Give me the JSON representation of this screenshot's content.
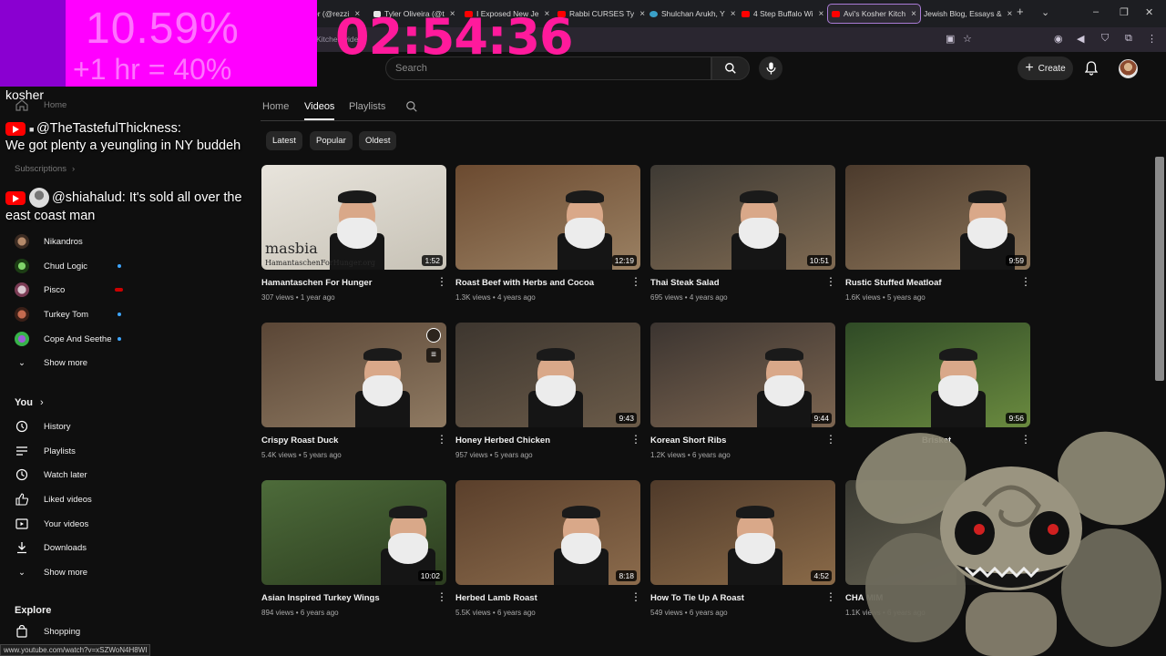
{
  "browser": {
    "tabs": [
      {
        "label": "er (@rezzi",
        "color": "#c9c9c9"
      },
      {
        "label": "Tyler Oliveira (@t",
        "color": "#e6e6e6"
      },
      {
        "label": "I Exposed New Je",
        "color": "#ff0000"
      },
      {
        "label": "Rabbi CURSES Ty",
        "color": "#ff0000"
      },
      {
        "label": "Shulchan Arukh, Y",
        "color": "#3aa0c8"
      },
      {
        "label": "4 Step Buffalo Wi",
        "color": "#ff0000"
      },
      {
        "label": "Avi's Kosher Kitch",
        "color": "#ff0000"
      },
      {
        "label": "Jewish Blog, Essays &",
        "color": "#6e6e6e"
      }
    ],
    "address_fragment": "Kitchen/videos"
  },
  "header": {
    "search_placeholder": "Search",
    "create_label": "Create"
  },
  "channel_tabs": {
    "home": "Home",
    "videos": "Videos",
    "playlists": "Playlists"
  },
  "chips": {
    "latest": "Latest",
    "popular": "Popular",
    "oldest": "Oldest"
  },
  "sidebar": {
    "home": "Home",
    "subscriptions": "Subscriptions",
    "subs": [
      {
        "name": "Nikandros",
        "live": false
      },
      {
        "name": "Chud Logic",
        "live": true
      },
      {
        "name": "Pisco",
        "live": true
      },
      {
        "name": "Turkey Tom",
        "live": true
      },
      {
        "name": "Cope And Seethe",
        "live": true
      }
    ],
    "show_more_1": "Show more",
    "you": "You",
    "you_items": [
      "History",
      "Playlists",
      "Watch later",
      "Liked videos",
      "Your videos",
      "Downloads"
    ],
    "show_more_2": "Show more",
    "explore": "Explore",
    "shopping": "Shopping"
  },
  "videos": [
    {
      "title": "Hamantaschen For Hunger",
      "views": "307 views",
      "age": "1 year ago",
      "duration": "1:52",
      "watermark": "masbia",
      "sub_watermark": "HamantaschenForHunger.org"
    },
    {
      "title": "Roast Beef with Herbs and Cocoa",
      "views": "1.3K views",
      "age": "4 years ago",
      "duration": "12:19"
    },
    {
      "title": "Thai Steak Salad",
      "views": "695 views",
      "age": "4 years ago",
      "duration": "10:51"
    },
    {
      "title": "Rustic Stuffed Meatloaf",
      "views": "1.6K views",
      "age": "5 years ago",
      "duration": "9:59"
    },
    {
      "title": "Crispy Roast Duck",
      "views": "5.4K views",
      "age": "5 years ago",
      "duration": ""
    },
    {
      "title": "Honey Herbed Chicken",
      "views": "957 views",
      "age": "5 years ago",
      "duration": "9:43"
    },
    {
      "title": "Korean Short Ribs",
      "views": "1.2K views",
      "age": "6 years ago",
      "duration": "9:44"
    },
    {
      "title": "Brisket",
      "views": "",
      "age": "",
      "duration": "9:56"
    },
    {
      "title": "Asian Inspired Turkey Wings",
      "views": "894 views",
      "age": "6 years ago",
      "duration": "10:02"
    },
    {
      "title": "Herbed Lamb Roast",
      "views": "5.5K views",
      "age": "6 years ago",
      "duration": "8:18"
    },
    {
      "title": "How To Tie Up A Roast",
      "views": "549 views",
      "age": "6 years ago",
      "duration": "4:52"
    },
    {
      "title": "CHA MIM",
      "views": "1.1K views",
      "age": "6 years ago",
      "duration": ""
    }
  ],
  "overlay": {
    "percent": "10.59%",
    "bonus": "+1 hr = 40%",
    "timer": "02:54:36",
    "kosher": "kosher",
    "chat": [
      {
        "user": "@TheTastefulThickness:",
        "message": "We got plenty a yeungling in NY buddeh"
      },
      {
        "user": "@shiahalud:",
        "message": "It's sold all over the east coast man"
      }
    ]
  },
  "status_url": "www.youtube.com/watch?v=xSZWoN4H8WI",
  "colors": {
    "accent": "#ff1a9c",
    "pct_bg": "#ff00ff",
    "yt_red": "#ff0000",
    "live_blue": "#3ea6ff"
  }
}
